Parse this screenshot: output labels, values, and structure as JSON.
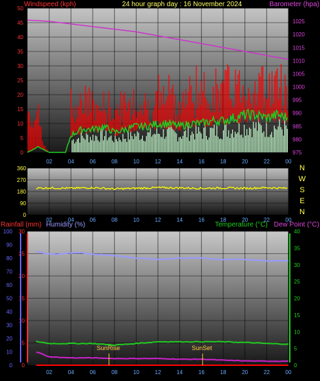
{
  "header": {
    "left_label": "Windspeed (kph)",
    "title": "24 hour graph day : 16 November 2024",
    "right_label": "Barometer (hpa)"
  },
  "colors": {
    "background": "#000000",
    "wind": "#ff0000",
    "wind_avg": "#22cc22",
    "wind_calm": "#c8ffd0",
    "barometer": "#cc33cc",
    "direction": "#ffff00",
    "humidity": "#9999ff",
    "temperature": "#22cc22",
    "dewpoint": "#cc22cc",
    "rainfall": "#ff0000",
    "sun": "#ffcc44",
    "title": "#ffff66"
  },
  "direction_labels": [
    "N",
    "W",
    "S",
    "E",
    "N"
  ],
  "bottom_header": {
    "rain_label": "Rainfall (mm)",
    "humidity_label": "Humidity (%)",
    "temp_label": "Temperature (°C)",
    "dew_label": "Dew Point (°C)"
  },
  "sun_labels": {
    "rise": "SunRise",
    "set": "SunSet"
  },
  "chart_data": [
    {
      "type": "line",
      "title": "24 hour graph day : 16 November 2024",
      "x_ticks": [
        "02",
        "04",
        "06",
        "08",
        "10",
        "12",
        "14",
        "16",
        "18",
        "20",
        "22",
        "00"
      ],
      "xlim": [
        0,
        24
      ],
      "left_axis": {
        "label": "Windspeed (kph)",
        "ylim": [
          0,
          50
        ],
        "ticks": [
          0,
          5,
          10,
          15,
          20,
          25,
          30,
          35,
          40,
          45,
          50
        ]
      },
      "right_axis": {
        "label": "Barometer (hpa)",
        "ylim": [
          975,
          1030
        ],
        "ticks": [
          975,
          980,
          985,
          990,
          995,
          1000,
          1005,
          1010,
          1015,
          1020,
          1025
        ]
      },
      "series": [
        {
          "name": "Barometer (hpa)",
          "axis": "right",
          "x": [
            0,
            2,
            4,
            6,
            8,
            10,
            12,
            14,
            16,
            18,
            20,
            22,
            24
          ],
          "values": [
            1025.5,
            1025,
            1024,
            1023,
            1022,
            1021,
            1019.5,
            1018,
            1016.5,
            1015,
            1013.5,
            1012,
            1010.5
          ]
        },
        {
          "axis": "left",
          "x": [
            0,
            0.5,
            1,
            1.5,
            2,
            3.5,
            4,
            5,
            6,
            7,
            8,
            9,
            10,
            11,
            12,
            13,
            14,
            15,
            16,
            17,
            18,
            19,
            20,
            21,
            22,
            23,
            24
          ],
          "values": [
            12,
            8,
            14,
            3,
            0,
            0,
            18,
            19,
            17,
            17,
            16,
            17,
            18,
            17,
            19,
            21,
            18,
            22,
            21,
            23,
            23,
            25,
            24,
            24,
            24,
            25,
            23
          ]
        },
        {
          "axis": "left",
          "x": [
            0,
            1,
            2,
            3.5,
            4,
            5,
            6,
            7,
            8,
            9,
            10,
            11,
            12,
            13,
            14,
            15,
            16,
            17,
            18,
            19,
            20,
            21,
            22,
            23,
            24
          ],
          "values": [
            0,
            2,
            0,
            0,
            6,
            8,
            8,
            9,
            7,
            8,
            9,
            9,
            10,
            10,
            9,
            10,
            10,
            11,
            11,
            12,
            13,
            13,
            12,
            13,
            12
          ]
        }
      ]
    },
    {
      "type": "line",
      "x_ticks": [
        "02",
        "04",
        "06",
        "08",
        "10",
        "12",
        "14",
        "16",
        "18",
        "20",
        "22",
        "00"
      ],
      "xlim": [
        0,
        24
      ],
      "ylim": [
        0,
        360
      ],
      "y_ticks": [
        0,
        90,
        180,
        270,
        360
      ],
      "series": [
        {
          "x": [
            0,
            2,
            4,
            6,
            8,
            10,
            12,
            14,
            16,
            18,
            20,
            22,
            24
          ],
          "values": [
            205,
            208,
            205,
            210,
            200,
            205,
            210,
            208,
            205,
            208,
            205,
            210,
            205
          ]
        }
      ]
    },
    {
      "type": "line",
      "x_ticks": [
        "02",
        "04",
        "06",
        "08",
        "10",
        "12",
        "14",
        "16",
        "18",
        "20",
        "22",
        "00"
      ],
      "xlim": [
        0,
        24
      ],
      "rain_axis": {
        "label": "Rainfall (mm)",
        "ylim": [
          0,
          30
        ],
        "ticks": [
          0,
          5,
          10,
          15,
          20,
          25,
          30
        ]
      },
      "humidity_axis": {
        "label": "Humidity (%)",
        "ylim": [
          0,
          100
        ],
        "ticks": [
          0,
          10,
          20,
          30,
          40,
          50,
          60,
          70,
          80,
          90,
          100
        ]
      },
      "temp_axis": {
        "label": "Temperature (°C)",
        "ylim": [
          0,
          40
        ],
        "ticks": [
          0,
          5,
          10,
          15,
          20,
          25,
          30,
          35,
          40
        ]
      },
      "series": [
        {
          "name": "Humidity (%)",
          "axis": "humidity",
          "x": [
            0,
            1,
            2,
            3,
            4,
            5,
            6,
            8,
            10,
            12,
            14,
            16,
            18,
            20,
            22,
            24
          ],
          "values": [
            86,
            85,
            83,
            83,
            84,
            84,
            83,
            82,
            80,
            79,
            80,
            80,
            79,
            79,
            78,
            78
          ]
        },
        {
          "name": "Temperature (°C)",
          "axis": "temp",
          "x": [
            0,
            1,
            2,
            4,
            6,
            8,
            10,
            12,
            14,
            16,
            18,
            20,
            22,
            24
          ],
          "values": [
            7.5,
            7,
            6.5,
            6.5,
            6.5,
            6,
            6.5,
            7,
            7,
            7,
            7,
            6.8,
            6.5,
            6.3
          ]
        },
        {
          "name": "Dew Point (°C)",
          "axis": "temp",
          "x": [
            0,
            1,
            2,
            4,
            6,
            8,
            10,
            12,
            14,
            16,
            18,
            20,
            22,
            24
          ],
          "values": [
            4,
            3.8,
            2.5,
            2.2,
            2.2,
            2,
            2,
            2,
            1.8,
            1.8,
            1.5,
            1.3,
            1.2,
            1.2
          ]
        },
        {
          "name": "Rainfall (mm)",
          "axis": "rain",
          "x": [
            0,
            24
          ],
          "values": [
            0,
            0
          ]
        }
      ],
      "sunrise_hour": 7.5,
      "sunset_hour": 16.1
    }
  ]
}
